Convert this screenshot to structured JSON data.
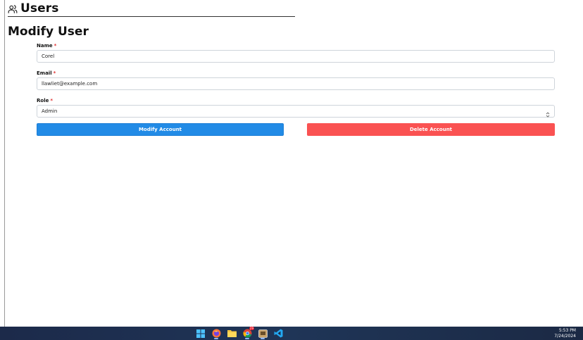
{
  "header": {
    "title": "Users",
    "icon": "users-icon"
  },
  "page_title": "Modify User",
  "form": {
    "name": {
      "label": "Name",
      "required_mark": "*",
      "value": "Corel"
    },
    "email": {
      "label": "Email",
      "required_mark": "*",
      "value": "llawliet@example.com"
    },
    "role": {
      "label": "Role",
      "required_mark": "*",
      "selected": "Admin"
    }
  },
  "actions": {
    "modify_label": "Modify Account",
    "delete_label": "Delete Account"
  },
  "colors": {
    "primary": "#228be6",
    "danger": "#fa5252",
    "required": "#e03131"
  },
  "taskbar": {
    "icons": [
      "windows-start-icon",
      "firefox-icon",
      "file-explorer-icon",
      "chrome-icon",
      "app-icon",
      "vscode-icon"
    ],
    "notification_badge": "29",
    "time": "5:53 PM",
    "date": "7/24/2024"
  }
}
